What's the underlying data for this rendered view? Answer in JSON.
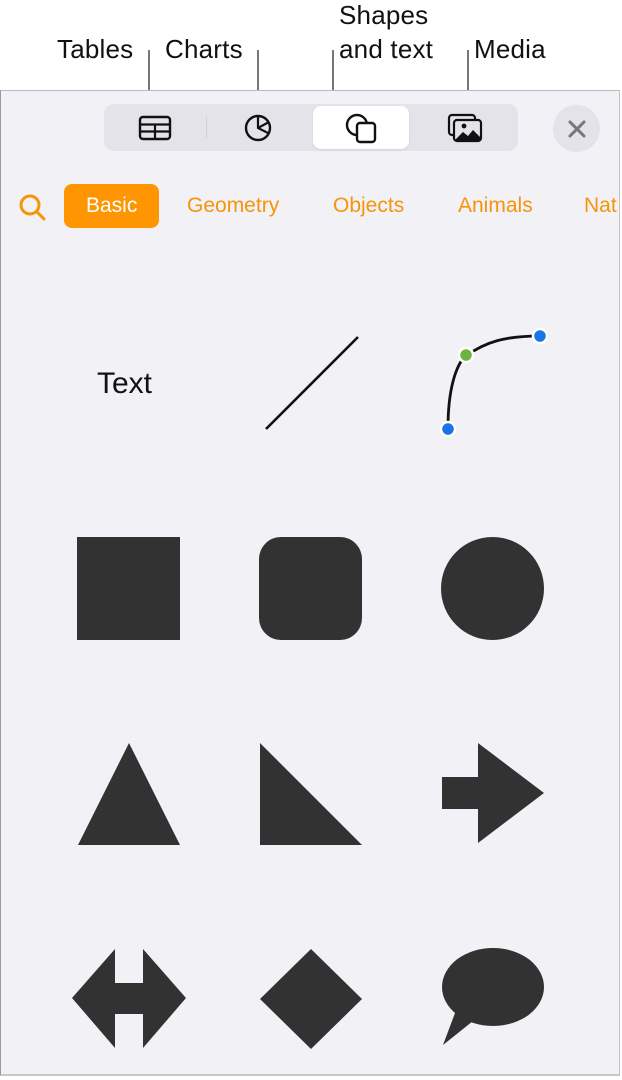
{
  "callouts": {
    "tables": "Tables",
    "charts": "Charts",
    "shapes_line1": "Shapes",
    "shapes_line2": "and text",
    "media": "Media"
  },
  "toolbar": {
    "segments": [
      {
        "label": "Tables",
        "icon": "table-icon",
        "active": false
      },
      {
        "label": "Charts",
        "icon": "pie-chart-icon",
        "active": false
      },
      {
        "label": "Shapes and text",
        "icon": "shapes-icon",
        "active": true
      },
      {
        "label": "Media",
        "icon": "photos-icon",
        "active": false
      }
    ],
    "close_icon": "close-icon"
  },
  "categories": {
    "search_icon": "search-icon",
    "items": [
      {
        "label": "Basic",
        "active": true
      },
      {
        "label": "Geometry",
        "active": false
      },
      {
        "label": "Objects",
        "active": false
      },
      {
        "label": "Animals",
        "active": false
      },
      {
        "label": "Nat",
        "active": false
      }
    ]
  },
  "shapes": {
    "text_label": "Text",
    "items": [
      "text",
      "line",
      "curve",
      "square",
      "rounded-square",
      "circle",
      "triangle",
      "right-triangle",
      "arrow-right",
      "double-arrow",
      "diamond",
      "speech-bubble"
    ]
  },
  "colors": {
    "accent": "#ff9500",
    "accent_text": "#f7940a",
    "shape_fill": "#323232",
    "panel_bg": "#f2f1f6",
    "curve_handle_end": "#1a73e8",
    "curve_handle_mid": "#6cb33f"
  }
}
